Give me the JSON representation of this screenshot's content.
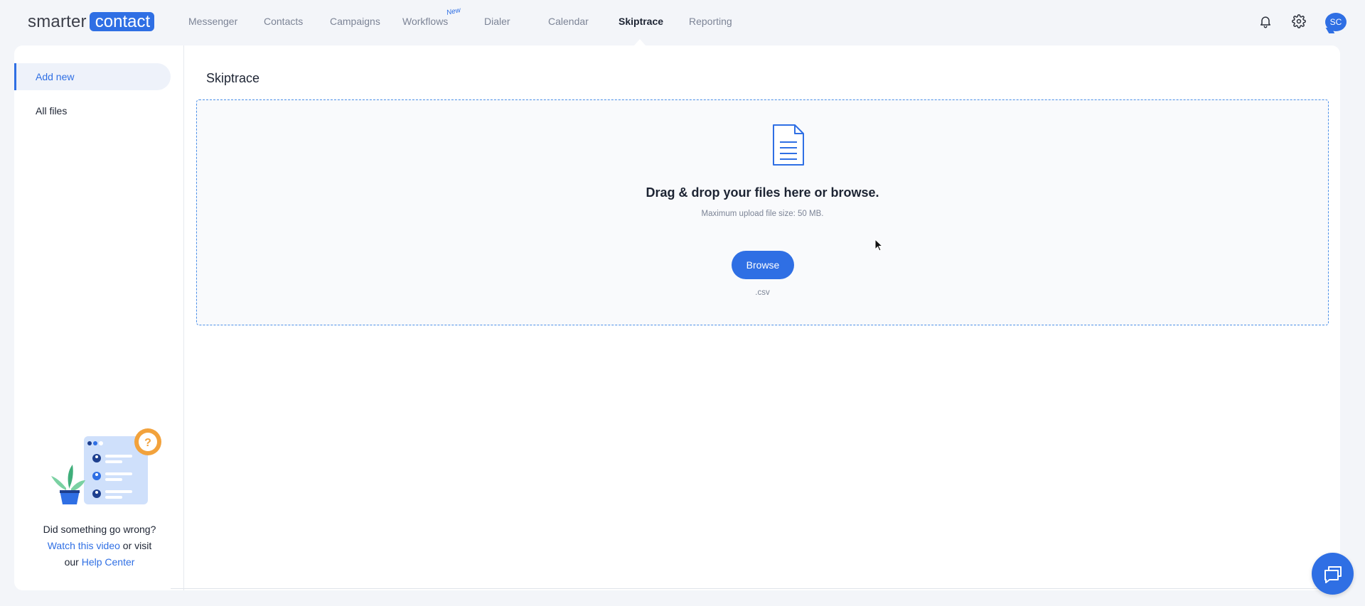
{
  "brand": {
    "word1": "smarter",
    "word2": "contact"
  },
  "nav": {
    "items": [
      {
        "label": "Messenger"
      },
      {
        "label": "Contacts"
      },
      {
        "label": "Campaigns"
      },
      {
        "label": "Workflows"
      },
      {
        "label": "Dialer"
      },
      {
        "label": "Calendar"
      },
      {
        "label": "Skiptrace",
        "active": true
      },
      {
        "label": "Reporting"
      }
    ],
    "new_badge": "New",
    "icons": [
      "bell-icon",
      "gear-icon"
    ],
    "avatar_initials": "SC"
  },
  "sidebar": {
    "items": [
      {
        "label": "Add new",
        "active": true
      },
      {
        "label": "All files"
      }
    ],
    "help": {
      "line1": "Did something go wrong?",
      "video_link": "Watch this video",
      "or_visit": " or visit",
      "our": "our ",
      "help_link": "Help Center"
    }
  },
  "main": {
    "title": "Skiptrace",
    "dropzone": {
      "title": "Drag & drop your files here or browse.",
      "subtitle": "Maximum upload file size: 50 MB.",
      "button": "Browse",
      "extension": ".csv"
    }
  },
  "colors": {
    "accent": "#2f6fe4",
    "background": "#f3f5f9"
  }
}
